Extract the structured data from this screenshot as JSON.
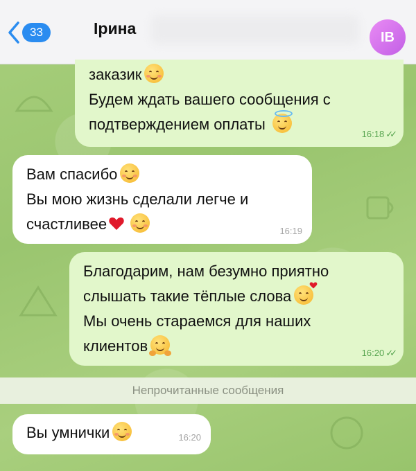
{
  "header": {
    "back_count": "33",
    "contact_name": "Ірина",
    "avatar_initials": "IB"
  },
  "messages": [
    {
      "direction": "out",
      "lines": [
        "заказик",
        "Будем ждать вашего сообщения с",
        "подтверждением оплаты"
      ],
      "time": "16:18",
      "status": "read"
    },
    {
      "direction": "in",
      "lines": [
        "Вам спасибо",
        "Вы мою жизнь сделали легче и",
        "счастливее"
      ],
      "time": "16:19"
    },
    {
      "direction": "out",
      "lines": [
        "Благодарим, нам безумно приятно",
        "слышать такие тёплые слова",
        "Мы очень стараемся для наших",
        "клиентов"
      ],
      "time": "16:20",
      "status": "read"
    },
    {
      "direction": "in",
      "lines": [
        "Вы умнички"
      ],
      "time": "16:20"
    }
  ],
  "unread_divider": "Непрочитанные сообщения",
  "colors": {
    "outgoing_bubble": "#e2f7cb",
    "incoming_bubble": "#ffffff",
    "accent": "#2a8cf0",
    "avatar": "#d070ee"
  }
}
